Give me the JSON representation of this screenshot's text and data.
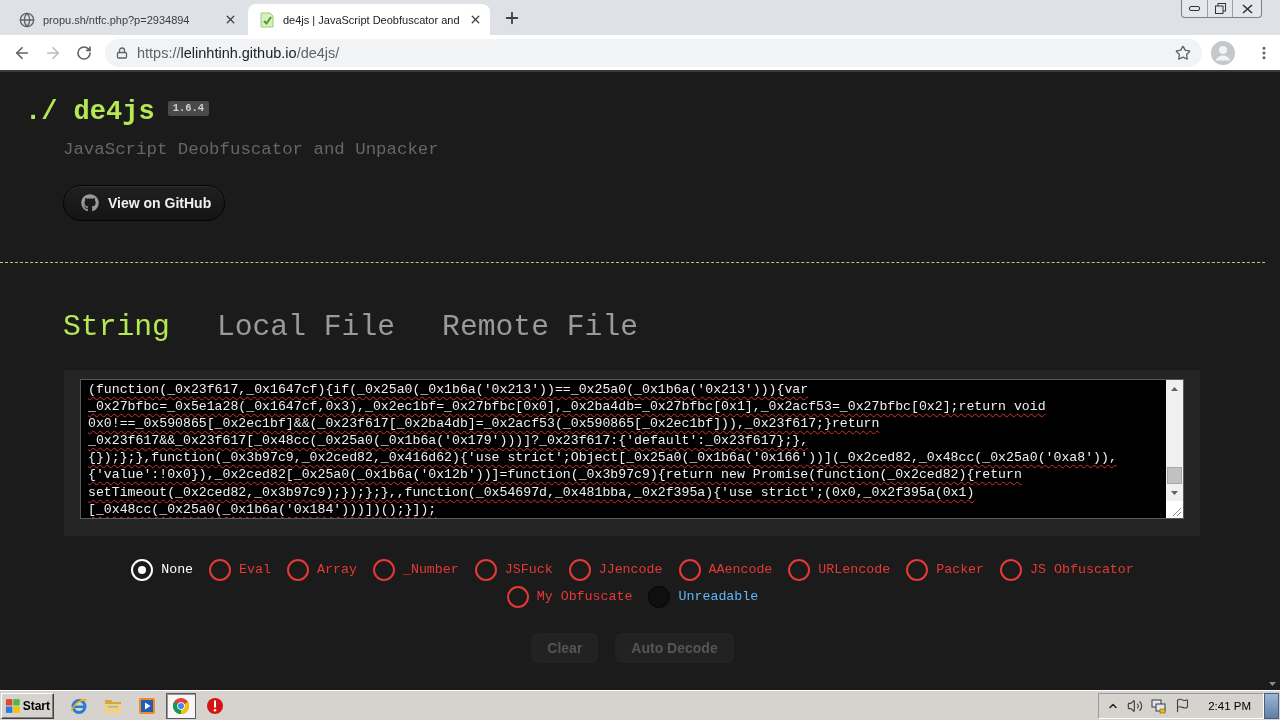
{
  "browser": {
    "tabs": [
      {
        "title": "propu.sh/ntfc.php?p=2934894",
        "selected": false
      },
      {
        "title": "de4js | JavaScript Deobfuscator and",
        "selected": true
      }
    ],
    "back_disabled": false,
    "forward_disabled": true,
    "address": {
      "scheme": "https://",
      "host": "lelinhtinh.github.io",
      "path": "/de4js/"
    }
  },
  "header": {
    "logo": "./ de4js",
    "version": "1.6.4",
    "subtitle": "JavaScript Deobfuscator and Unpacker",
    "github_button": "View on GitHub"
  },
  "input_tabs": [
    {
      "label": "String",
      "selected": true
    },
    {
      "label": "Local File",
      "selected": false
    },
    {
      "label": "Remote File",
      "selected": false
    }
  ],
  "editor": {
    "lines": [
      "(function(_0x23f617,_0x1647cf){if(_0x25a0(_0x1b6a('0x213'))==_0x25a0(_0x1b6a('0x213'))){var",
      "_0x27bfbc=_0x5e1a28(_0x1647cf,0x3),_0x2ec1bf=_0x27bfbc[0x0],_0x2ba4db=_0x27bfbc[0x1],_0x2acf53=_0x27bfbc[0x2];return void",
      "0x0!==_0x590865[_0x2ec1bf]&&(_0x23f617[_0x2ba4db]=_0x2acf53(_0x590865[_0x2ec1bf])),_0x23f617;}return",
      "_0x23f617&&_0x23f617[_0x48cc(_0x25a0(_0x1b6a('0x179')))]?_0x23f617:{'default':_0x23f617};},",
      "{});};},function(_0x3b97c9,_0x2ced82,_0x416d62){'use strict';Object[_0x25a0(_0x1b6a('0x166'))](_0x2ced82,_0x48cc(_0x25a0('0xa8')),",
      "{'value':!0x0}),_0x2ced82[_0x25a0(_0x1b6a('0x12b'))]=function(_0x3b97c9){return new Promise(function(_0x2ced82){return",
      "setTimeout(_0x2ced82,_0x3b97c9);});};},,function(_0x54697d,_0x481bba,_0x2f395a){'use strict';(0x0,_0x2f395a(0x1)",
      "[_0x48cc(_0x25a0(_0x1b6a('0x184')))])();}]);"
    ]
  },
  "methods": [
    {
      "label": "None",
      "selected": true,
      "disabled": false,
      "color": "#ffffff"
    },
    {
      "label": "Eval",
      "selected": false,
      "disabled": false,
      "color": "#e53935"
    },
    {
      "label": "Array",
      "selected": false,
      "disabled": false,
      "color": "#e53935"
    },
    {
      "label": "_Number",
      "selected": false,
      "disabled": false,
      "color": "#e53935"
    },
    {
      "label": "JSFuck",
      "selected": false,
      "disabled": false,
      "color": "#e53935"
    },
    {
      "label": "JJencode",
      "selected": false,
      "disabled": false,
      "color": "#e53935"
    },
    {
      "label": "AAencode",
      "selected": false,
      "disabled": false,
      "color": "#e53935"
    },
    {
      "label": "URLencode",
      "selected": false,
      "disabled": false,
      "color": "#e53935"
    },
    {
      "label": "Packer",
      "selected": false,
      "disabled": false,
      "color": "#e53935"
    },
    {
      "label": "JS Obfuscator",
      "selected": false,
      "disabled": false,
      "color": "#e53935"
    },
    {
      "label": "My Obfuscate",
      "selected": false,
      "disabled": false,
      "color": "#e53935"
    },
    {
      "label": "Unreadable",
      "selected": false,
      "disabled": true,
      "color": "#64b5f6"
    }
  ],
  "buttons": [
    {
      "label": "Clear",
      "disabled": true
    },
    {
      "label": "Auto Decode",
      "disabled": true
    }
  ],
  "taskbar": {
    "start": "Start",
    "apps": [
      {
        "kind": "explorer",
        "active": false
      },
      {
        "kind": "folder",
        "active": false
      },
      {
        "kind": "media",
        "active": false
      },
      {
        "kind": "chrome",
        "active": true
      },
      {
        "kind": "alert",
        "active": false
      }
    ],
    "clock": "2:41 PM"
  }
}
